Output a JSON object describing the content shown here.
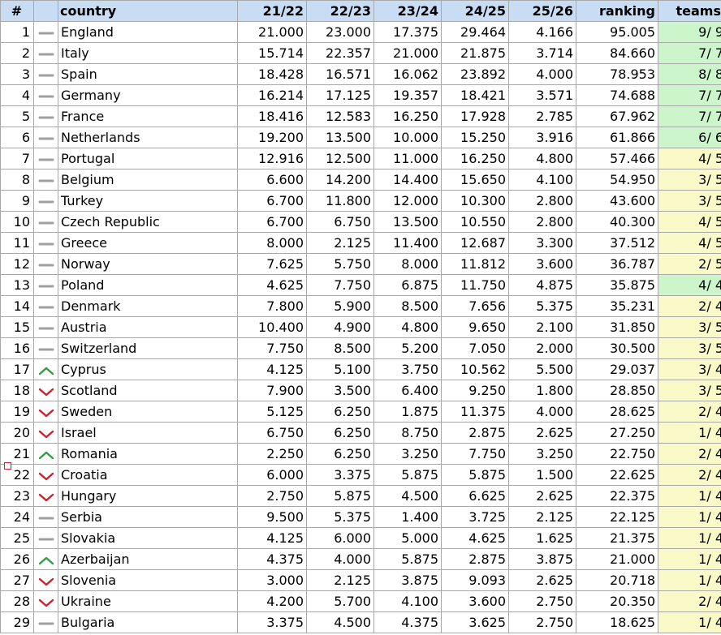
{
  "table": {
    "headers": {
      "rank": "#",
      "trend": "",
      "country": "country",
      "y2122": "21/22",
      "y2223": "22/23",
      "y2324": "23/24",
      "y2425": "24/25",
      "y2526": "25/26",
      "ranking": "ranking",
      "teams": "teams"
    },
    "rows": [
      {
        "rank": "1",
        "trend": "same",
        "country": "England",
        "y2122": "21.000",
        "y2223": "23.000",
        "y2324": "17.375",
        "y2425": "29.464",
        "y2526": "4.166",
        "ranking": "95.005",
        "teams": "9/ 9",
        "teams_status": "green"
      },
      {
        "rank": "2",
        "trend": "same",
        "country": "Italy",
        "y2122": "15.714",
        "y2223": "22.357",
        "y2324": "21.000",
        "y2425": "21.875",
        "y2526": "3.714",
        "ranking": "84.660",
        "teams": "7/ 7",
        "teams_status": "green"
      },
      {
        "rank": "3",
        "trend": "same",
        "country": "Spain",
        "y2122": "18.428",
        "y2223": "16.571",
        "y2324": "16.062",
        "y2425": "23.892",
        "y2526": "4.000",
        "ranking": "78.953",
        "teams": "8/ 8",
        "teams_status": "green"
      },
      {
        "rank": "4",
        "trend": "same",
        "country": "Germany",
        "y2122": "16.214",
        "y2223": "17.125",
        "y2324": "19.357",
        "y2425": "18.421",
        "y2526": "3.571",
        "ranking": "74.688",
        "teams": "7/ 7",
        "teams_status": "green"
      },
      {
        "rank": "5",
        "trend": "same",
        "country": "France",
        "y2122": "18.416",
        "y2223": "12.583",
        "y2324": "16.250",
        "y2425": "17.928",
        "y2526": "2.785",
        "ranking": "67.962",
        "teams": "7/ 7",
        "teams_status": "green"
      },
      {
        "rank": "6",
        "trend": "same",
        "country": "Netherlands",
        "y2122": "19.200",
        "y2223": "13.500",
        "y2324": "10.000",
        "y2425": "15.250",
        "y2526": "3.916",
        "ranking": "61.866",
        "teams": "6/ 6",
        "teams_status": "green"
      },
      {
        "rank": "7",
        "trend": "same",
        "country": "Portugal",
        "y2122": "12.916",
        "y2223": "12.500",
        "y2324": "11.000",
        "y2425": "16.250",
        "y2526": "4.800",
        "ranking": "57.466",
        "teams": "4/ 5",
        "teams_status": "yellow"
      },
      {
        "rank": "8",
        "trend": "same",
        "country": "Belgium",
        "y2122": "6.600",
        "y2223": "14.200",
        "y2324": "14.400",
        "y2425": "15.650",
        "y2526": "4.100",
        "ranking": "54.950",
        "teams": "3/ 5",
        "teams_status": "yellow"
      },
      {
        "rank": "9",
        "trend": "same",
        "country": "Turkey",
        "y2122": "6.700",
        "y2223": "11.800",
        "y2324": "12.000",
        "y2425": "10.300",
        "y2526": "2.800",
        "ranking": "43.600",
        "teams": "3/ 5",
        "teams_status": "yellow"
      },
      {
        "rank": "10",
        "trend": "same",
        "country": "Czech Republic",
        "y2122": "6.700",
        "y2223": "6.750",
        "y2324": "13.500",
        "y2425": "10.550",
        "y2526": "2.800",
        "ranking": "40.300",
        "teams": "4/ 5",
        "teams_status": "yellow"
      },
      {
        "rank": "11",
        "trend": "same",
        "country": "Greece",
        "y2122": "8.000",
        "y2223": "2.125",
        "y2324": "11.400",
        "y2425": "12.687",
        "y2526": "3.300",
        "ranking": "37.512",
        "teams": "4/ 5",
        "teams_status": "yellow"
      },
      {
        "rank": "12",
        "trend": "same",
        "country": "Norway",
        "y2122": "7.625",
        "y2223": "5.750",
        "y2324": "8.000",
        "y2425": "11.812",
        "y2526": "3.600",
        "ranking": "36.787",
        "teams": "2/ 5",
        "teams_status": "yellow"
      },
      {
        "rank": "13",
        "trend": "same",
        "country": "Poland",
        "y2122": "4.625",
        "y2223": "7.750",
        "y2324": "6.875",
        "y2425": "11.750",
        "y2526": "4.875",
        "ranking": "35.875",
        "teams": "4/ 4",
        "teams_status": "green"
      },
      {
        "rank": "14",
        "trend": "same",
        "country": "Denmark",
        "y2122": "7.800",
        "y2223": "5.900",
        "y2324": "8.500",
        "y2425": "7.656",
        "y2526": "5.375",
        "ranking": "35.231",
        "teams": "2/ 4",
        "teams_status": "yellow"
      },
      {
        "rank": "15",
        "trend": "same",
        "country": "Austria",
        "y2122": "10.400",
        "y2223": "4.900",
        "y2324": "4.800",
        "y2425": "9.650",
        "y2526": "2.100",
        "ranking": "31.850",
        "teams": "3/ 5",
        "teams_status": "yellow"
      },
      {
        "rank": "16",
        "trend": "same",
        "country": "Switzerland",
        "y2122": "7.750",
        "y2223": "8.500",
        "y2324": "5.200",
        "y2425": "7.050",
        "y2526": "2.000",
        "ranking": "30.500",
        "teams": "3/ 5",
        "teams_status": "yellow"
      },
      {
        "rank": "17",
        "trend": "up",
        "country": "Cyprus",
        "y2122": "4.125",
        "y2223": "5.100",
        "y2324": "3.750",
        "y2425": "10.562",
        "y2526": "5.500",
        "ranking": "29.037",
        "teams": "3/ 4",
        "teams_status": "yellow"
      },
      {
        "rank": "18",
        "trend": "down",
        "country": "Scotland",
        "y2122": "7.900",
        "y2223": "3.500",
        "y2324": "6.400",
        "y2425": "9.250",
        "y2526": "1.800",
        "ranking": "28.850",
        "teams": "3/ 5",
        "teams_status": "yellow"
      },
      {
        "rank": "19",
        "trend": "down",
        "country": "Sweden",
        "y2122": "5.125",
        "y2223": "6.250",
        "y2324": "1.875",
        "y2425": "11.375",
        "y2526": "4.000",
        "ranking": "28.625",
        "teams": "2/ 4",
        "teams_status": "yellow"
      },
      {
        "rank": "20",
        "trend": "down",
        "country": "Israel",
        "y2122": "6.750",
        "y2223": "6.250",
        "y2324": "8.750",
        "y2425": "2.875",
        "y2526": "2.625",
        "ranking": "27.250",
        "teams": "1/ 4",
        "teams_status": "yellow"
      },
      {
        "rank": "21",
        "trend": "up",
        "country": "Romania",
        "y2122": "2.250",
        "y2223": "6.250",
        "y2324": "3.250",
        "y2425": "7.750",
        "y2526": "3.250",
        "ranking": "22.750",
        "teams": "2/ 4",
        "teams_status": "yellow"
      },
      {
        "rank": "22",
        "trend": "down",
        "country": "Croatia",
        "y2122": "6.000",
        "y2223": "3.375",
        "y2324": "5.875",
        "y2425": "5.875",
        "y2526": "1.500",
        "ranking": "22.625",
        "teams": "2/ 4",
        "teams_status": "yellow",
        "selected": true
      },
      {
        "rank": "23",
        "trend": "down",
        "country": "Hungary",
        "y2122": "2.750",
        "y2223": "5.875",
        "y2324": "4.500",
        "y2425": "6.625",
        "y2526": "2.625",
        "ranking": "22.375",
        "teams": "1/ 4",
        "teams_status": "yellow"
      },
      {
        "rank": "24",
        "trend": "same",
        "country": "Serbia",
        "y2122": "9.500",
        "y2223": "5.375",
        "y2324": "1.400",
        "y2425": "3.725",
        "y2526": "2.125",
        "ranking": "22.125",
        "teams": "1/ 4",
        "teams_status": "yellow"
      },
      {
        "rank": "25",
        "trend": "same",
        "country": "Slovakia",
        "y2122": "4.125",
        "y2223": "6.000",
        "y2324": "5.000",
        "y2425": "4.625",
        "y2526": "1.625",
        "ranking": "21.375",
        "teams": "1/ 4",
        "teams_status": "yellow"
      },
      {
        "rank": "26",
        "trend": "up",
        "country": "Azerbaijan",
        "y2122": "4.375",
        "y2223": "4.000",
        "y2324": "5.875",
        "y2425": "2.875",
        "y2526": "3.875",
        "ranking": "21.000",
        "teams": "1/ 4",
        "teams_status": "yellow"
      },
      {
        "rank": "27",
        "trend": "down",
        "country": "Slovenia",
        "y2122": "3.000",
        "y2223": "2.125",
        "y2324": "3.875",
        "y2425": "9.093",
        "y2526": "2.625",
        "ranking": "20.718",
        "teams": "1/ 4",
        "teams_status": "yellow"
      },
      {
        "rank": "28",
        "trend": "down",
        "country": "Ukraine",
        "y2122": "4.200",
        "y2223": "5.700",
        "y2324": "4.100",
        "y2425": "3.600",
        "y2526": "2.750",
        "ranking": "20.350",
        "teams": "2/ 4",
        "teams_status": "yellow"
      },
      {
        "rank": "29",
        "trend": "same",
        "country": "Bulgaria",
        "y2122": "3.375",
        "y2223": "4.500",
        "y2324": "4.375",
        "y2425": "3.625",
        "y2526": "2.750",
        "ranking": "18.625",
        "teams": "1/ 4",
        "teams_status": "yellow"
      }
    ]
  },
  "trend_icons": {
    "same": "dash-icon",
    "up": "chevron-up-icon",
    "down": "chevron-down-icon"
  },
  "colors": {
    "header_bg": "#c8dcf4",
    "teams_full": "#ccf5cc",
    "teams_partial": "#fafac8",
    "trend_up": "#2ea043",
    "trend_down": "#d0202a",
    "trend_same": "#a0a0a0",
    "selection": "#d0202a"
  }
}
